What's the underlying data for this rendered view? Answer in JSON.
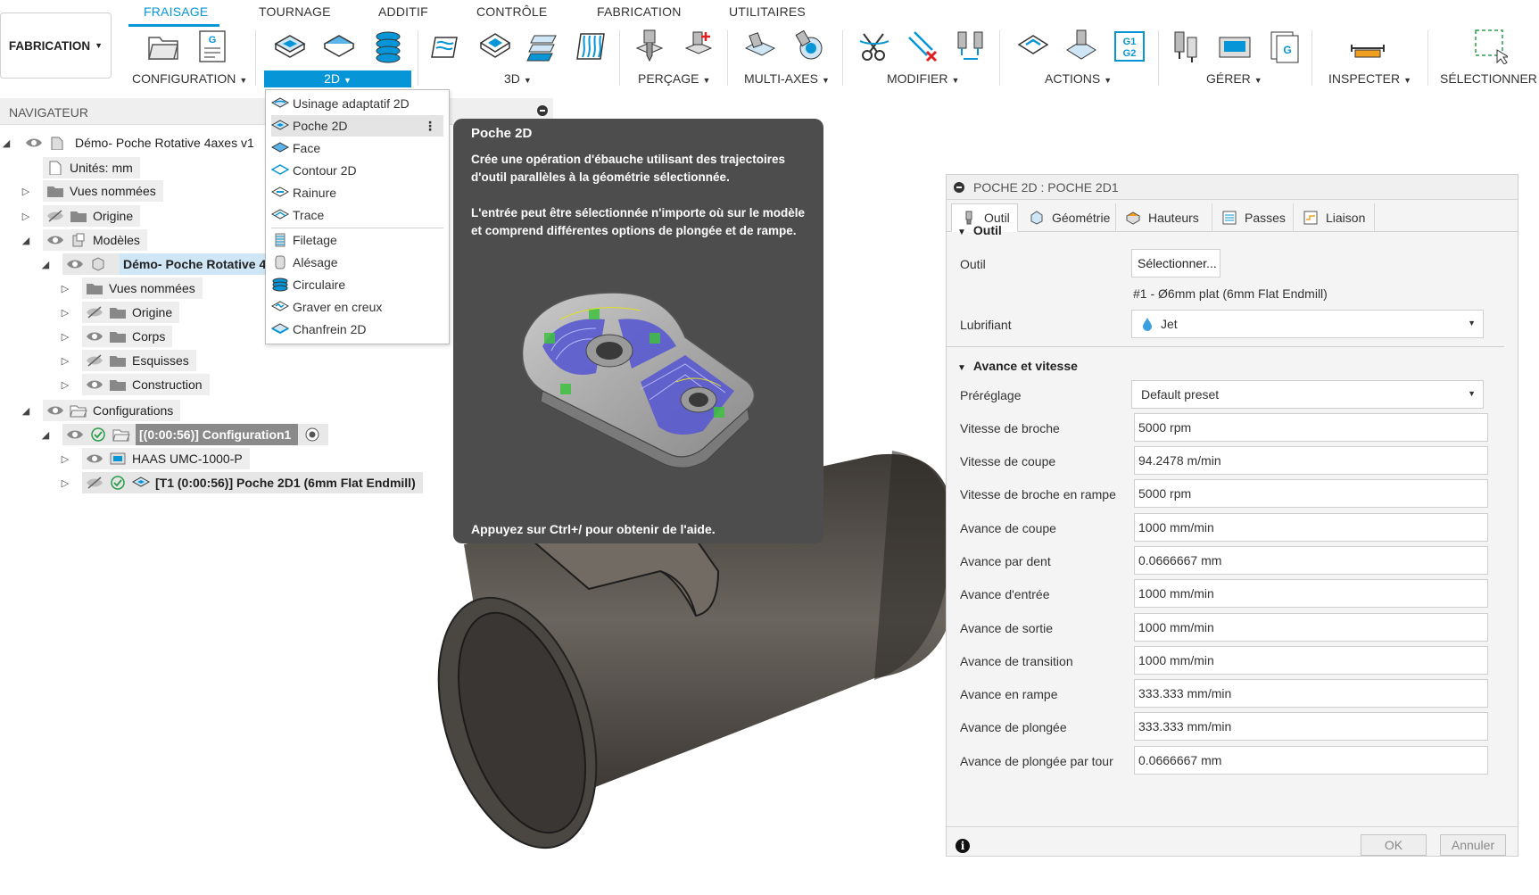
{
  "workspace": {
    "label": "FABRICATION"
  },
  "tabs": [
    {
      "label": "FRAISAGE",
      "active": true
    },
    {
      "label": "TOURNAGE"
    },
    {
      "label": "ADDITIF"
    },
    {
      "label": "CONTRÔLE"
    },
    {
      "label": "FABRICATION"
    },
    {
      "label": "UTILITAIRES"
    }
  ],
  "toolbar_groups": {
    "configuration": "CONFIGURATION",
    "2d": "2D",
    "3d": "3D",
    "percage": "PERÇAGE",
    "multiaxes": "MULTI-AXES",
    "modifier": "MODIFIER",
    "actions": "ACTIONS",
    "gerer": "GÉRER",
    "inspecter": "INSPECTER",
    "selectionner": "SÉLECTIONNER"
  },
  "toolbar_icons": {
    "g_code_label": "G",
    "g1g2_label": "G1 G2"
  },
  "navigator": {
    "title": "NAVIGATEUR",
    "items": {
      "root": "Démo- Poche Rotative 4axes v1",
      "units": "Unités: mm",
      "named_views": "Vues nommées",
      "origin": "Origine",
      "models": "Modèles",
      "model": "Démo- Poche Rotative 4",
      "model_named_views": "Vues nommées",
      "model_origin": "Origine",
      "bodies": "Corps",
      "sketches": "Esquisses",
      "construction": "Construction",
      "setups": "Configurations",
      "setup1": "[(0:00:56)] Configuration1",
      "machine": "HAAS UMC-1000-P",
      "operation": "[T1 (0:00:56)] Poche 2D1 (6mm Flat Endmill)"
    }
  },
  "dropdown_2d": [
    {
      "label": "Usinage adaptatif 2D"
    },
    {
      "label": "Poche 2D",
      "hover": true
    },
    {
      "label": "Face"
    },
    {
      "label": "Contour 2D"
    },
    {
      "label": "Rainure"
    },
    {
      "label": "Trace"
    },
    {
      "label": "Filetage"
    },
    {
      "label": "Alésage"
    },
    {
      "label": "Circulaire"
    },
    {
      "label": "Graver en creux"
    },
    {
      "label": "Chanfrein 2D"
    }
  ],
  "tooltip": {
    "title": "Poche 2D",
    "p1": "Crée une opération d'ébauche utilisant des trajectoires d'outil parallèles à la géométrie sélectionnée.",
    "p2": "L'entrée peut être sélectionnée n'importe où sur le modèle et comprend différentes options de plongée et de rampe.",
    "help": "Appuyez sur Ctrl+/ pour obtenir de l'aide."
  },
  "panel": {
    "title": "POCHE 2D : POCHE 2D1",
    "tabs": [
      "Outil",
      "Géométrie",
      "Hauteurs",
      "Passes",
      "Liaison"
    ],
    "section_tool": "Outil",
    "tool_label": "Outil",
    "tool_button": "Sélectionner...",
    "tool_desc": "#1 - Ø6mm plat (6mm Flat Endmill)",
    "coolant_label": "Lubrifiant",
    "coolant_value": "Jet",
    "section_feed": "Avance et vitesse",
    "preset_label": "Préréglage",
    "preset_value": "Default preset",
    "fields": [
      {
        "label": "Vitesse de broche",
        "value": "5000 rpm"
      },
      {
        "label": "Vitesse de coupe",
        "value": "94.2478 m/min"
      },
      {
        "label": "Vitesse de broche en rampe",
        "value": "5000 rpm"
      },
      {
        "label": "Avance de coupe",
        "value": "1000 mm/min"
      },
      {
        "label": "Avance par dent",
        "value": "0.0666667 mm"
      },
      {
        "label": "Avance d'entrée",
        "value": "1000 mm/min"
      },
      {
        "label": "Avance de sortie",
        "value": "1000 mm/min"
      },
      {
        "label": "Avance de transition",
        "value": "1000 mm/min"
      },
      {
        "label": "Avance en rampe",
        "value": "333.333 mm/min"
      },
      {
        "label": "Avance de plongée",
        "value": "333.333 mm/min"
      },
      {
        "label": "Avance de plongée par tour",
        "value": "0.0666667 mm"
      }
    ],
    "ok": "OK",
    "cancel": "Annuler"
  },
  "colors": {
    "accent": "#0696d7",
    "tooltip_bg": "#4d4d4d",
    "toolpath": "#3a3ad6"
  }
}
